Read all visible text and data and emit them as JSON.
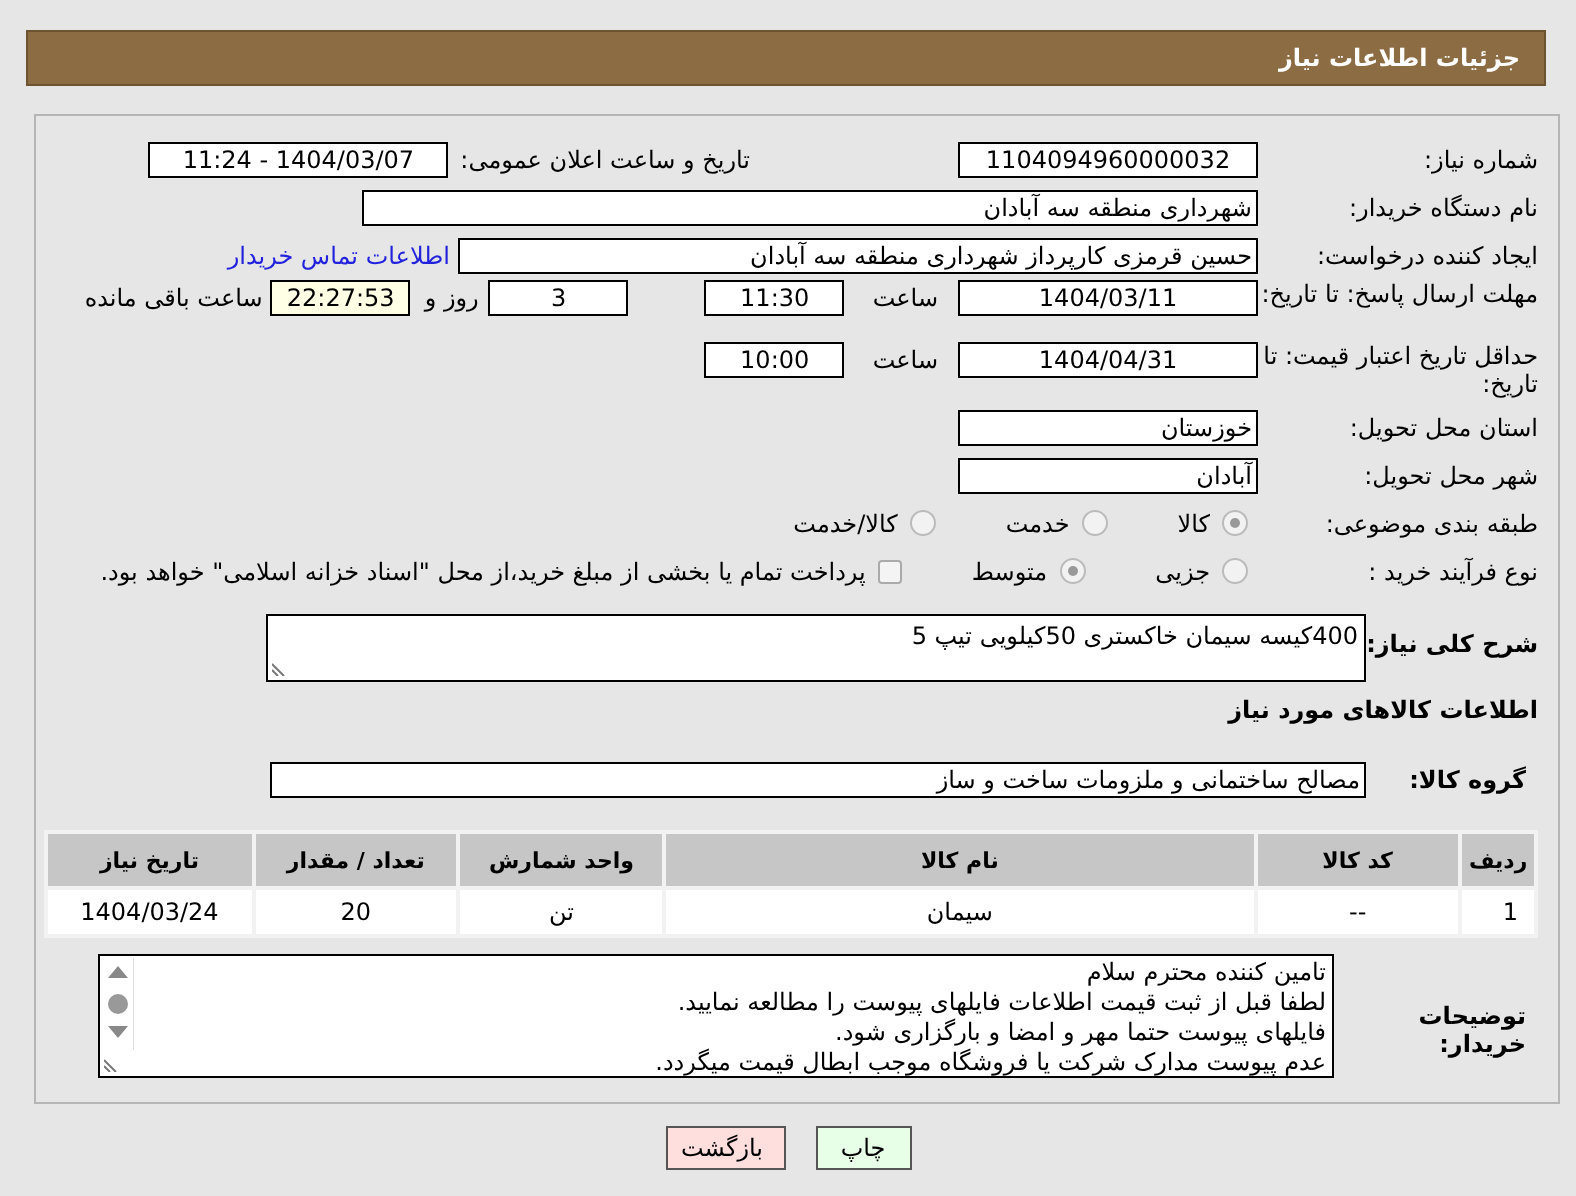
{
  "header": {
    "title": "جزئیات اطلاعات نیاز"
  },
  "need_number": {
    "label": "شماره نیاز:",
    "value": "1104094960000032"
  },
  "announce": {
    "label": "تاریخ و ساعت اعلان عمومی:",
    "value": "1404/03/07 - 11:24"
  },
  "buyer_org": {
    "label": "نام دستگاه خریدار:",
    "value": "شهرداری منطقه سه آبادان"
  },
  "requester": {
    "label": "ایجاد کننده درخواست:",
    "value": "حسین قرمزی کارپرداز شهرداری منطقه سه آبادان",
    "link": "اطلاعات تماس خریدار"
  },
  "response_deadline": {
    "label": "مهلت ارسال پاسخ: تا تاریخ:",
    "date": "1404/03/11",
    "time_label": "ساعت",
    "time": "11:30",
    "days": "3",
    "days_label": "روز و",
    "remaining": "22:27:53",
    "remaining_label": "ساعت باقی مانده"
  },
  "price_validity": {
    "label": "حداقل تاریخ اعتبار قیمت: تا تاریخ:",
    "date": "1404/04/31",
    "time_label": "ساعت",
    "time": "10:00"
  },
  "province": {
    "label": "استان محل تحویل:",
    "value": "خوزستان"
  },
  "city": {
    "label": "شهر محل تحویل:",
    "value": "آبادان"
  },
  "category": {
    "label": "طبقه بندی موضوعی:",
    "options": [
      {
        "label": "کالا",
        "selected": true
      },
      {
        "label": "خدمت",
        "selected": false
      },
      {
        "label": "کالا/خدمت",
        "selected": false
      }
    ]
  },
  "process": {
    "label": "نوع فرآیند خرید :",
    "options": [
      {
        "label": "جزیی",
        "selected": false
      },
      {
        "label": "متوسط",
        "selected": true
      }
    ],
    "payment_note": {
      "label": "پرداخت تمام یا بخشی از مبلغ خرید،از محل \"اسناد خزانه اسلامی\" خواهد بود.",
      "checked": false
    }
  },
  "description": {
    "label": "شرح کلی نیاز:",
    "value": "400کیسه سیمان خاکستری 50کیلویی تیپ 5"
  },
  "items_heading": "اطلاعات کالاهای مورد نیاز",
  "goods_group": {
    "label": "گروه کالا:",
    "value": "مصالح ساختمانی و ملزومات ساخت و ساز"
  },
  "table": {
    "columns": [
      "ردیف",
      "کد کالا",
      "نام کالا",
      "واحد شمارش",
      "تعداد / مقدار",
      "تاریخ نیاز"
    ],
    "rows": [
      [
        "1",
        "--",
        "سیمان",
        "تن",
        "20",
        "1404/03/24"
      ]
    ]
  },
  "buyer_notes": {
    "label": "توضیحات خریدار:",
    "lines": [
      "تامین کننده محترم سلام",
      "لطفا قبل از ثبت قیمت اطلاعات فایلهای پیوست را مطالعه نمایید.",
      "فایلهای پیوست حتما مهر و امضا و بارگزاری شود.",
      "عدم پیوست مدارک شرکت یا فروشگاه موجب ابطال قیمت میگردد."
    ]
  },
  "buttons": [
    {
      "label": "چاپ",
      "kind": "print"
    },
    {
      "label": "بازگشت",
      "kind": "back"
    }
  ]
}
